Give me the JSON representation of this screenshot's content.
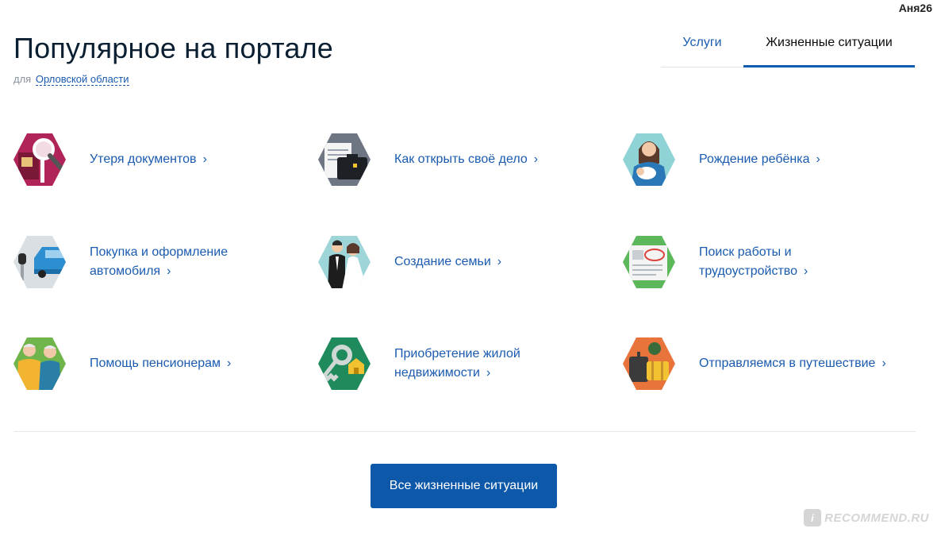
{
  "user": {
    "name": "Аня26"
  },
  "header": {
    "title": "Популярное на портале",
    "region_prefix": "для",
    "region_link": "Орловской области"
  },
  "tabs": [
    {
      "label": "Услуги",
      "active": false
    },
    {
      "label": "Жизненные ситуации",
      "active": true
    }
  ],
  "situations": [
    {
      "line1": "Утеря документов",
      "line2": "",
      "icon": "lost-documents-icon",
      "color": "#b1245a"
    },
    {
      "line1": "Как открыть своё дело",
      "line2": "",
      "icon": "open-business-icon",
      "color": "#6d7682"
    },
    {
      "line1": "Рождение ребёнка",
      "line2": "",
      "icon": "childbirth-icon",
      "color": "#8fd3d6"
    },
    {
      "line1": "Покупка и оформление",
      "line2": "автомобиля",
      "icon": "car-purchase-icon",
      "color": "#d9dfe3"
    },
    {
      "line1": "Создание семьи",
      "line2": "",
      "icon": "wedding-icon",
      "color": "#9ed5d8"
    },
    {
      "line1": "Поиск работы и",
      "line2": "трудоустройство",
      "icon": "job-search-icon",
      "color": "#5cb85a"
    },
    {
      "line1": "Помощь пенсионерам",
      "line2": "",
      "icon": "pensioners-icon",
      "color": "#6fb54b"
    },
    {
      "line1": "Приобретение жилой",
      "line2": "недвижимости",
      "icon": "real-estate-icon",
      "color": "#1f8a5c"
    },
    {
      "line1": "Отправляемся в путешествие",
      "line2": "",
      "icon": "travel-icon",
      "color": "#e8743b"
    }
  ],
  "footer": {
    "all_button": "Все жизненные ситуации"
  },
  "watermark": {
    "text": "RECOMMEND.RU",
    "badge": "i"
  }
}
